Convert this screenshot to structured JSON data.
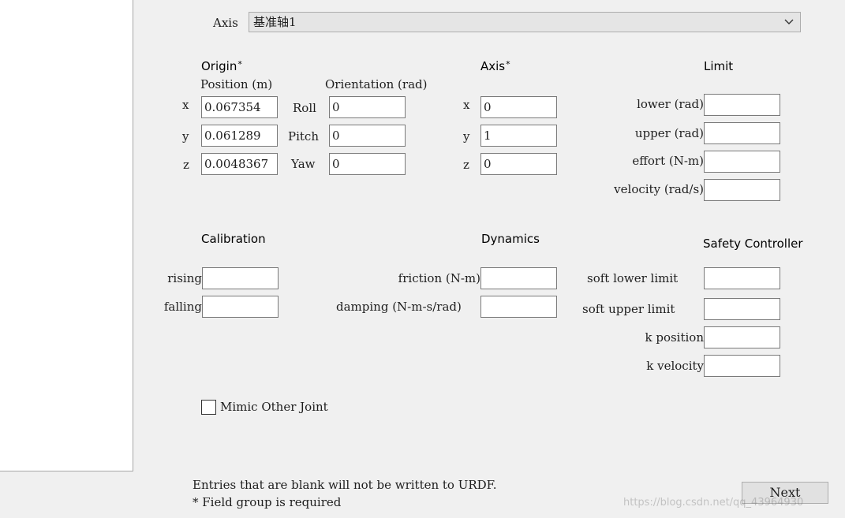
{
  "axis_selector": {
    "label": "Axis",
    "value": "基准轴1"
  },
  "origin": {
    "title": "Origin",
    "required_mark": "*",
    "position_header": "Position (m)",
    "orientation_header": "Orientation (rad)",
    "x_label": "x",
    "y_label": "y",
    "z_label": "z",
    "x": "0.067354",
    "y": "0.061289",
    "z": "0.0048367",
    "roll_label": "Roll",
    "pitch_label": "Pitch",
    "yaw_label": "Yaw",
    "roll": "0",
    "pitch": "0",
    "yaw": "0"
  },
  "axis": {
    "title": "Axis",
    "required_mark": "*",
    "x_label": "x",
    "y_label": "y",
    "z_label": "z",
    "x": "0",
    "y": "1",
    "z": "0"
  },
  "limit": {
    "title": "Limit",
    "lower_label": "lower (rad)",
    "upper_label": "upper (rad)",
    "effort_label": "effort (N-m)",
    "velocity_label": "velocity (rad/s)",
    "lower": "",
    "upper": "",
    "effort": "",
    "velocity": ""
  },
  "calibration": {
    "title": "Calibration",
    "rising_label": "rising",
    "falling_label": "falling",
    "rising": "",
    "falling": ""
  },
  "dynamics": {
    "title": "Dynamics",
    "friction_label": "friction (N-m)",
    "damping_label": "damping (N-m-s/rad)",
    "friction": "",
    "damping": ""
  },
  "safety": {
    "title": "Safety Controller",
    "soft_lower_label": "soft lower limit",
    "soft_upper_label": "soft upper limit",
    "k_position_label": "k position",
    "k_velocity_label": "k velocity",
    "soft_lower": "",
    "soft_upper": "",
    "k_position": "",
    "k_velocity": ""
  },
  "mimic": {
    "label": "Mimic Other Joint",
    "checked": false
  },
  "footer": {
    "note_blank": "Entries that are blank will not be written to URDF.",
    "note_required": "* Field group is required",
    "next_label": "Next"
  },
  "watermark": "https://blog.csdn.net/qq_43964930",
  "icons": {
    "dropdown": "chevron-down-icon",
    "checkbox": "checkbox-icon"
  }
}
